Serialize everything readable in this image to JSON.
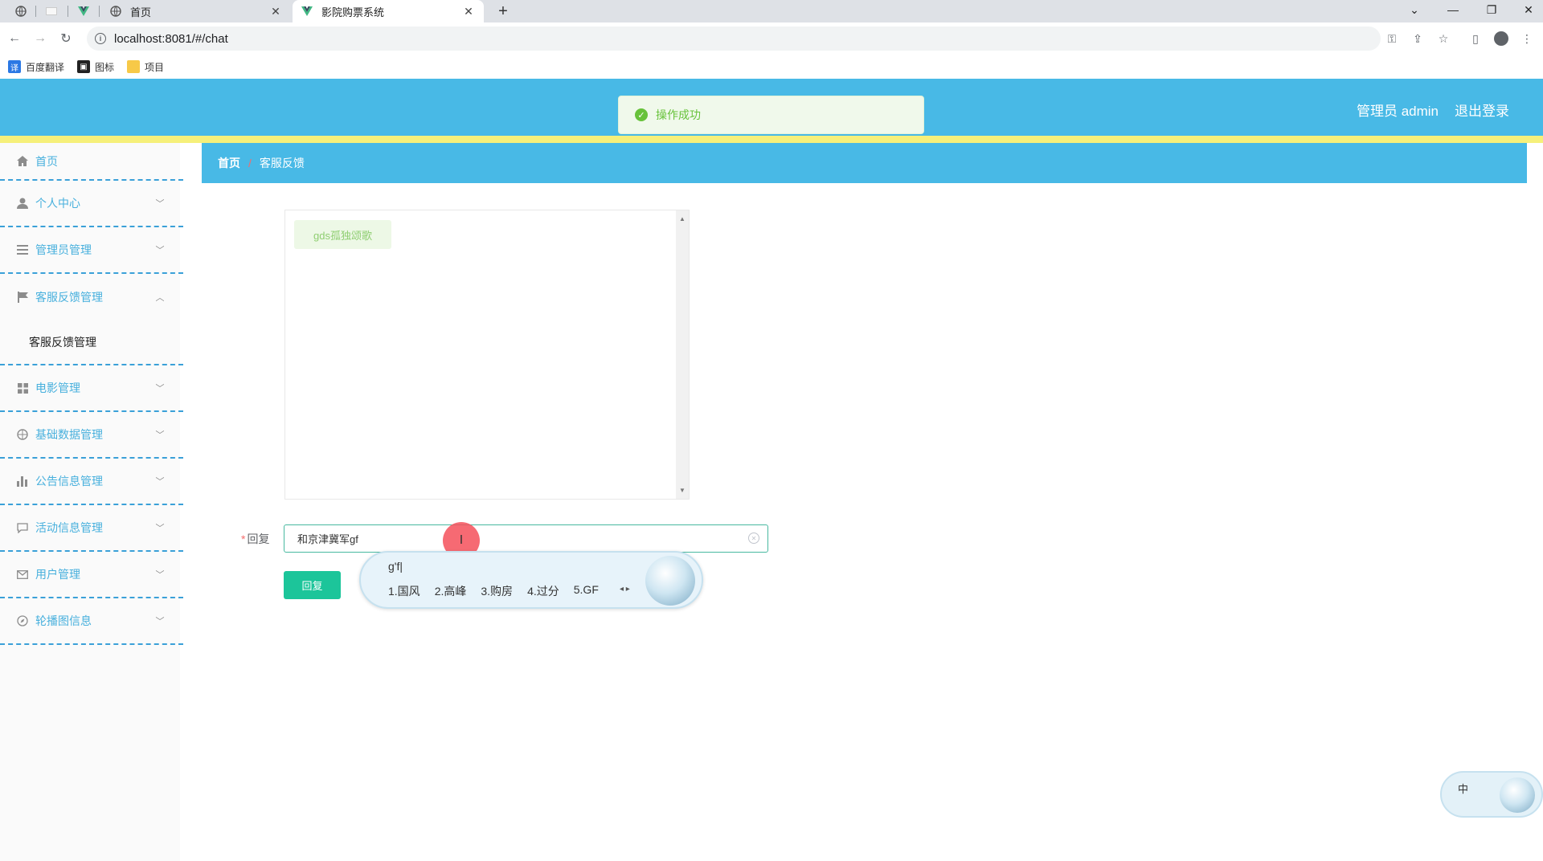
{
  "browser": {
    "tabs": [
      {
        "label": "首页",
        "icon": "globe-icon"
      },
      {
        "label": "影院购票系统",
        "icon": "vue-icon"
      }
    ],
    "url": "localhost:8081/#/chat",
    "bookmarks": [
      {
        "label": "百度翻译",
        "icon": "translate-icon"
      },
      {
        "label": "图标",
        "icon": "image-icon"
      },
      {
        "label": "项目",
        "icon": "folder-icon"
      }
    ]
  },
  "header": {
    "user": "管理员 admin",
    "logout": "退出登录",
    "bg_color": "#48b9e6",
    "stripe_color": "#f6f07a"
  },
  "toast": {
    "message": "操作成功",
    "status": "success"
  },
  "sidebar": {
    "items": [
      {
        "label": "首页",
        "icon": "home-icon"
      },
      {
        "label": "个人中心",
        "icon": "user-icon"
      },
      {
        "label": "管理员管理",
        "icon": "list-icon"
      },
      {
        "label": "客服反馈管理",
        "icon": "flag-icon"
      },
      {
        "label": "电影管理",
        "icon": "grid-icon"
      },
      {
        "label": "基础数据管理",
        "icon": "globe-icon"
      },
      {
        "label": "公告信息管理",
        "icon": "bar-chart-icon"
      },
      {
        "label": "活动信息管理",
        "icon": "chat-icon"
      },
      {
        "label": "用户管理",
        "icon": "mail-icon"
      },
      {
        "label": "轮播图信息",
        "icon": "compass-icon"
      }
    ],
    "submenu": {
      "label": "客服反馈管理"
    }
  },
  "breadcrumb": {
    "home": "首页",
    "separator": "/",
    "current": "客服反馈"
  },
  "chat": {
    "messages": [
      {
        "text": "gds孤独颂歌"
      }
    ]
  },
  "reply": {
    "label": "回复",
    "value": "和京津冀军gf",
    "button": "回复"
  },
  "ime": {
    "compose": "g'f|",
    "candidates": [
      "1.国风",
      "2.高峰",
      "3.购房",
      "4.过分",
      "5.GF"
    ],
    "status_lang": "中"
  }
}
